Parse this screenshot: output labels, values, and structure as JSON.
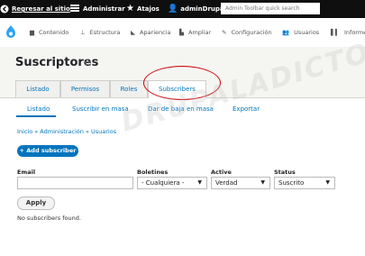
{
  "admin_bar": {
    "back_label": "Regresar al sitio",
    "manage_label": "Administrar",
    "shortcuts_label": "Atajos",
    "user_label": "adminDrupal",
    "search_placeholder": "Admin Toolbar quick search"
  },
  "menu": [
    {
      "label": "Contenido",
      "icon": "page-icon"
    },
    {
      "label": "Estructura",
      "icon": "sitemap-icon"
    },
    {
      "label": "Apariencia",
      "icon": "brush-icon"
    },
    {
      "label": "Ampliar",
      "icon": "puzzle-icon"
    },
    {
      "label": "Configuración",
      "icon": "wrench-icon"
    },
    {
      "label": "Usuarios",
      "icon": "people-icon"
    },
    {
      "label": "Informes",
      "icon": "bar-chart-icon"
    }
  ],
  "page": {
    "title": "Suscriptores",
    "primary_tabs": [
      "Listado",
      "Permisos",
      "Roles",
      "Subscribers"
    ],
    "active_primary_tab": "Subscribers",
    "secondary_tabs": [
      "Listado",
      "Suscribir en masa",
      "Dar de baja en masa",
      "Exportar"
    ],
    "breadcrumb": "Inicio » Administración » Usuarios",
    "add_button": "+ Add subscriber"
  },
  "filters": {
    "email_label": "Email",
    "email_value": "",
    "newsletters_label": "Boletines",
    "newsletters_value": "- Cualquiera -",
    "active_label": "Active",
    "active_value": "Verdad",
    "status_label": "Status",
    "status_value": "Suscrito",
    "apply_label": "Apply"
  },
  "empty_message": "No subscribers found.",
  "watermark": "DRUPALADICTO",
  "colors": {
    "accent": "#0074bd",
    "highlight": "#cc0000"
  }
}
